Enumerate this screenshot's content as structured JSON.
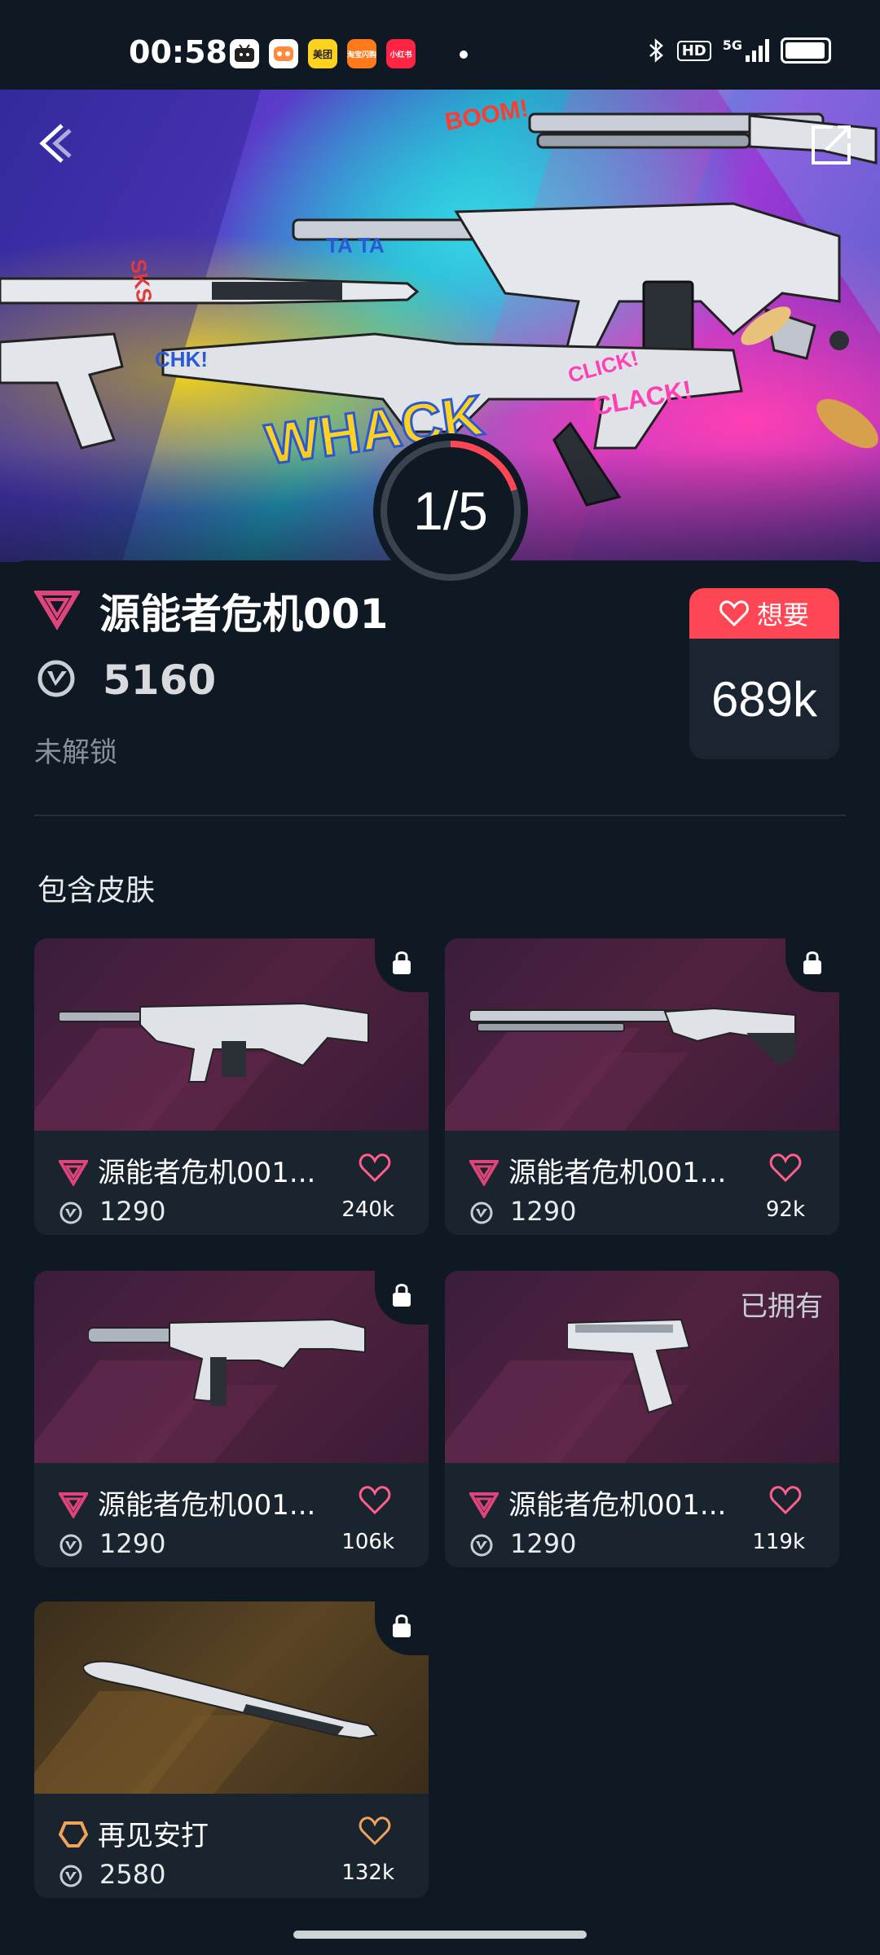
{
  "status_bar": {
    "time": "00:58",
    "apps": [
      {
        "icon": "bilibili-icon",
        "color": "#ffffff",
        "label": ""
      },
      {
        "icon": "game-icon",
        "color": "#ff8a3d",
        "label": ""
      },
      {
        "icon": "meituan-icon",
        "color": "#ffd21f",
        "label": "美团"
      },
      {
        "icon": "taobao-flash-icon",
        "color": "#ff7a1a",
        "label": "淘宝闪购"
      },
      {
        "icon": "xiaohongshu-icon",
        "color": "#ff2442",
        "label": "小红书"
      }
    ],
    "hd": "HD",
    "network": "5G"
  },
  "hero": {
    "counter": "1/5",
    "progress_fraction": 0.2,
    "accent": "#ff4655"
  },
  "bundle": {
    "title": "源能者危机001",
    "price": "5160",
    "status": "未解锁",
    "wish_label": "想要",
    "wish_count": "689k",
    "tier_color": "#e0447a"
  },
  "section": {
    "title": "包含皮肤"
  },
  "skins": [
    {
      "name": "源能者危机001...",
      "price": "1290",
      "likes": "240k",
      "locked": true,
      "owned_label": "",
      "weapon": "rifle",
      "tier": "pink"
    },
    {
      "name": "源能者危机001...",
      "price": "1290",
      "likes": "92k",
      "locked": true,
      "owned_label": "",
      "weapon": "shotgun",
      "tier": "pink"
    },
    {
      "name": "源能者危机001...",
      "price": "1290",
      "likes": "106k",
      "locked": true,
      "owned_label": "",
      "weapon": "smg",
      "tier": "pink"
    },
    {
      "name": "源能者危机001...",
      "price": "1290",
      "likes": "119k",
      "locked": false,
      "owned_label": "已拥有",
      "weapon": "pistol",
      "tier": "pink"
    },
    {
      "name": "再见安打",
      "price": "2580",
      "likes": "132k",
      "locked": true,
      "owned_label": "",
      "weapon": "bat",
      "tier": "orange"
    }
  ]
}
